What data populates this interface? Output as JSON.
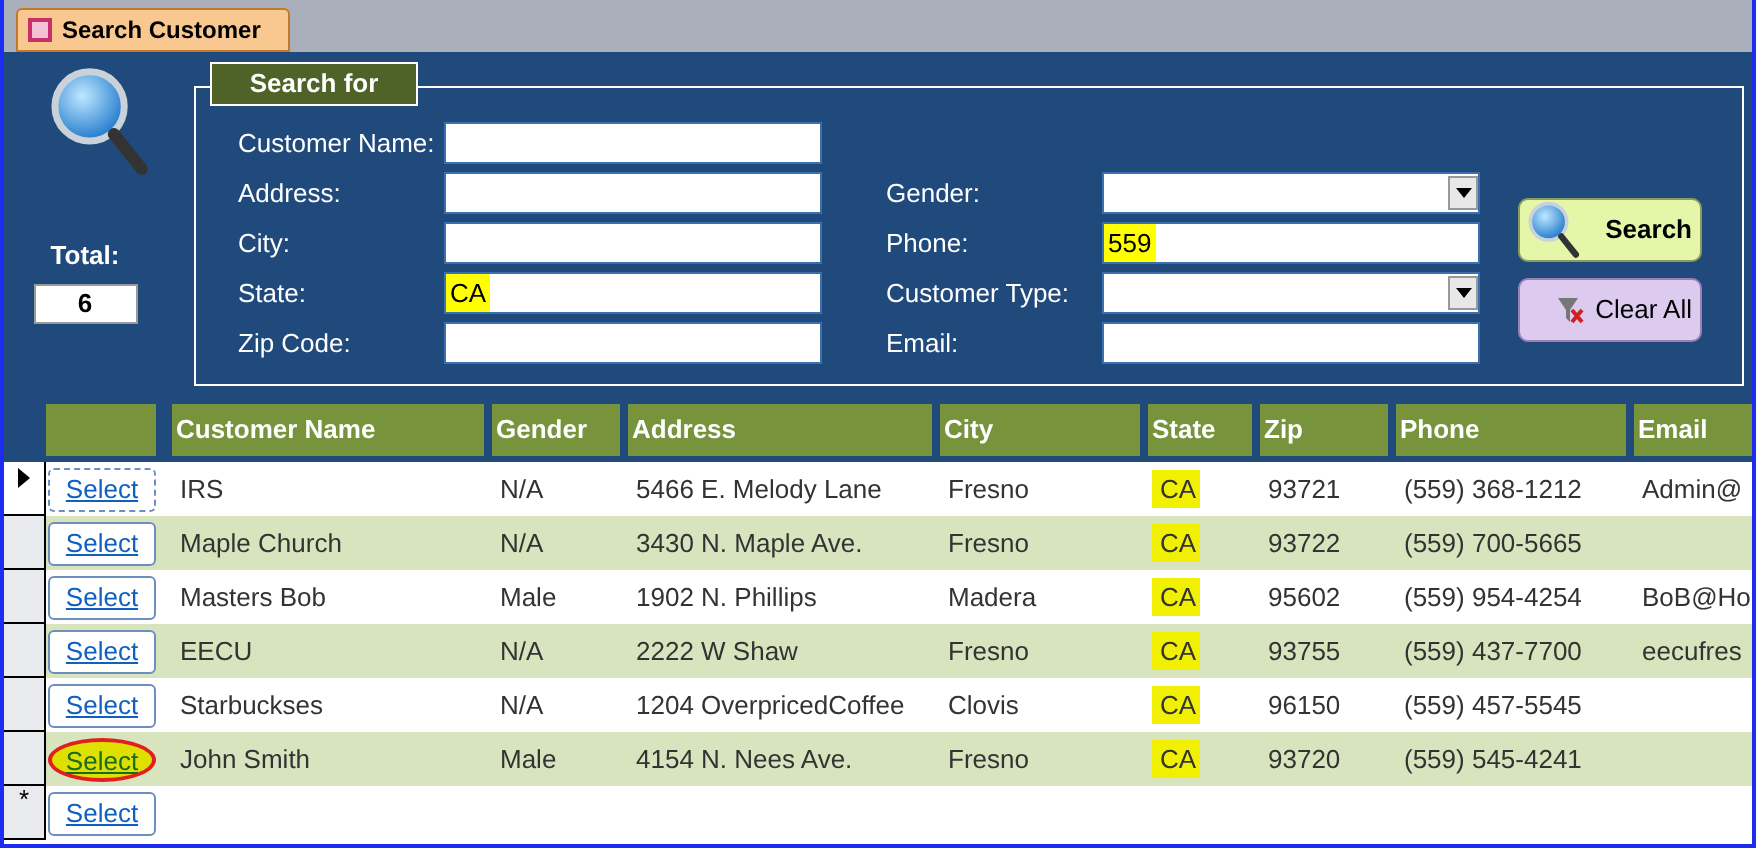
{
  "tab": {
    "label": "Search Customer",
    "selected": true
  },
  "search_for": {
    "legend": "Search for",
    "left_fields": [
      {
        "label": "Customer Name:",
        "kind": "text"
      },
      {
        "label": "Address:",
        "kind": "text"
      },
      {
        "label": "City:",
        "kind": "text"
      },
      {
        "label": "State:",
        "kind": "text",
        "value": "CA",
        "highlighted": true
      },
      {
        "label": "Zip Code:",
        "kind": "text"
      }
    ],
    "right_fields": [
      {
        "label": "Gender:",
        "kind": "dropdown"
      },
      {
        "label": "Phone:",
        "kind": "text",
        "value": "559",
        "highlighted": true
      },
      {
        "label": "Customer Type:",
        "kind": "dropdown"
      },
      {
        "label": "Email:",
        "kind": "text"
      }
    ],
    "buttons": [
      {
        "label": "Search",
        "kind": "search"
      },
      {
        "label": "Clear All",
        "kind": "clear"
      }
    ]
  },
  "total": {
    "label": "Total:",
    "value": "6"
  },
  "table": {
    "columns": [
      "Customer Name",
      "Gender",
      "Address",
      "City",
      "State",
      "Zip",
      "Phone",
      "Email"
    ],
    "rows": [
      {
        "current": true,
        "circled": false,
        "select": "Select",
        "cells": [
          "IRS",
          "N/A",
          "5466 E. Melody Lane",
          "Fresno",
          "CA",
          "93721",
          "(559) 368-1212",
          "Admin@"
        ]
      },
      {
        "current": false,
        "circled": false,
        "select": "Select",
        "cells": [
          "Maple Church",
          "N/A",
          "3430 N. Maple Ave.",
          "Fresno",
          "CA",
          "93722",
          "(559) 700-5665",
          ""
        ]
      },
      {
        "current": false,
        "circled": false,
        "select": "Select",
        "cells": [
          "Masters Bob",
          "Male",
          "1902 N. Phillips",
          "Madera",
          "CA",
          "95602",
          "(559) 954-4254",
          "BoB@Ho"
        ]
      },
      {
        "current": false,
        "circled": false,
        "select": "Select",
        "cells": [
          "EECU",
          "N/A",
          "2222 W Shaw",
          "Fresno",
          "CA",
          "93755",
          "(559) 437-7700",
          "eecufres"
        ]
      },
      {
        "current": false,
        "circled": false,
        "select": "Select",
        "cells": [
          "Starbuckses",
          "N/A",
          "1204 OverpricedCoffee",
          "Clovis",
          "CA",
          "96150",
          "(559) 457-5545",
          ""
        ]
      },
      {
        "current": false,
        "circled": true,
        "select": "Select",
        "cells": [
          "John Smith",
          "Male",
          "4154 N. Nees Ave.",
          "Fresno",
          "CA",
          "93720",
          "(559) 545-4241",
          ""
        ]
      }
    ],
    "new_row": {
      "marker": "*",
      "select": "Select"
    }
  }
}
